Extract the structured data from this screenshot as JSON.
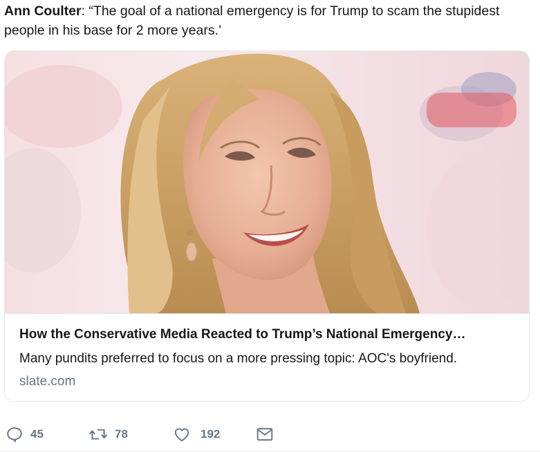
{
  "tweet": {
    "author": "Ann Coulter",
    "separator": ":",
    "quote": " “The goal of a national emergency is for Trump to scam the stupidest people in his base for 2 more years.’"
  },
  "card": {
    "image_icon": "photo-of-smiling-blonde-woman",
    "title": "How the Conservative Media Reacted to Trump’s National Emergency…",
    "description": "Many pundits preferred to focus on a more pressing topic: AOC's boyfriend.",
    "domain": "slate.com"
  },
  "actions": {
    "reply": {
      "icon": "reply-icon",
      "count": "45"
    },
    "retweet": {
      "icon": "retweet-icon",
      "count": "78"
    },
    "like": {
      "icon": "heart-icon",
      "count": "192"
    },
    "message": {
      "icon": "envelope-icon"
    }
  },
  "colors": {
    "text": "#14171a",
    "secondary": "#657786",
    "border": "#e1e8ed"
  }
}
